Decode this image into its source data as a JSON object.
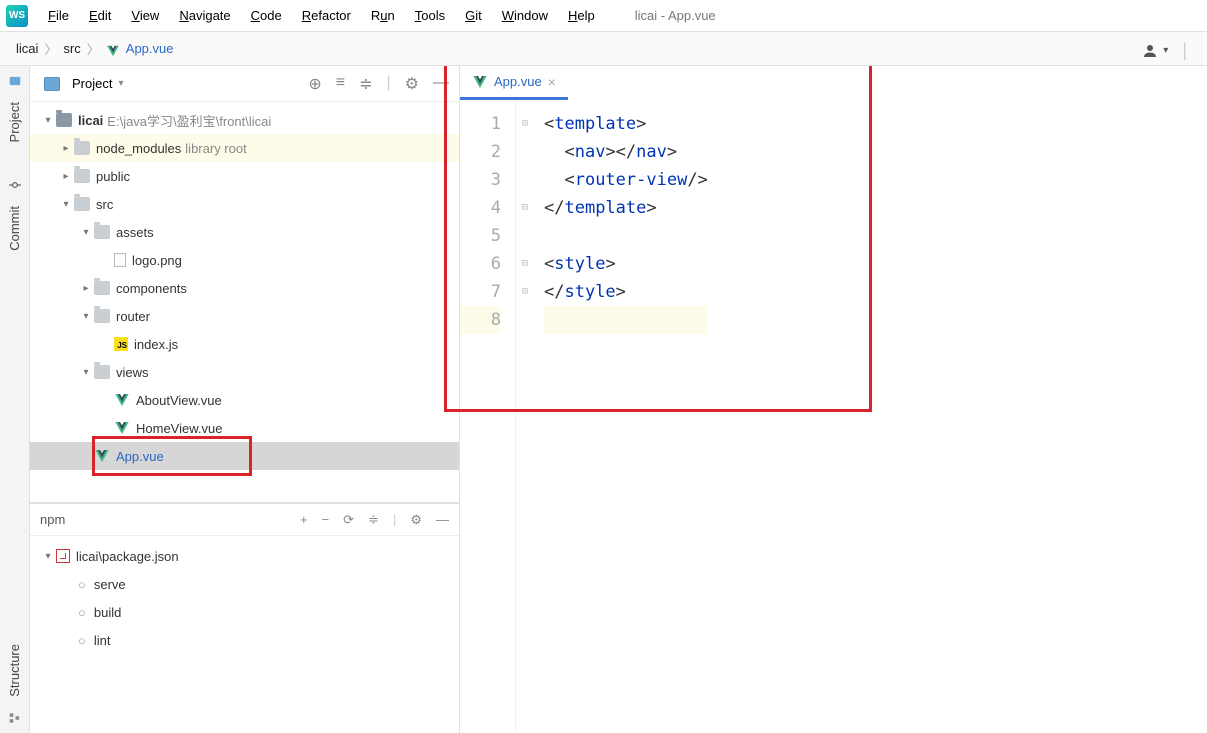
{
  "window_title": "licai - App.vue",
  "menubar": [
    "File",
    "Edit",
    "View",
    "Navigate",
    "Code",
    "Refactor",
    "Run",
    "Tools",
    "Git",
    "Window",
    "Help"
  ],
  "breadcrumb": {
    "root": "licai",
    "src": "src",
    "file": "App.vue"
  },
  "project": {
    "panel_title": "Project",
    "root": {
      "name": "licai",
      "path": "E:\\java学习\\盈利宝\\front\\licai"
    },
    "node_modules": "node_modules",
    "node_modules_tag": "library root",
    "public": "public",
    "src": "src",
    "assets": "assets",
    "logo": "logo.png",
    "components": "components",
    "router": "router",
    "indexjs": "index.js",
    "views": "views",
    "about": "AboutView.vue",
    "home": "HomeView.vue",
    "appvue": "App.vue"
  },
  "npm": {
    "title": "npm",
    "pkg": "licai\\package.json",
    "scripts": [
      "serve",
      "build",
      "lint"
    ]
  },
  "editor": {
    "tab": "App.vue",
    "lines": [
      "1",
      "2",
      "3",
      "4",
      "5",
      "6",
      "7",
      "8"
    ],
    "code": {
      "l1_open": "<",
      "l1_tag": "template",
      "l1_close": ">",
      "l2_open": "  <",
      "l2_tag": "nav",
      "l2_mid": "></",
      "l2_close": ">",
      "l3_open": "  <",
      "l3_tag": "router-view",
      "l3_close": "/>",
      "l4_open": "</",
      "l4_tag": "template",
      "l4_close": ">",
      "l6_open": "<",
      "l6_tag": "style",
      "l6_close": ">",
      "l7_open": "</",
      "l7_tag": "style",
      "l7_close": ">"
    }
  },
  "sidebar_tabs": {
    "project": "Project",
    "commit": "Commit",
    "structure": "Structure"
  }
}
